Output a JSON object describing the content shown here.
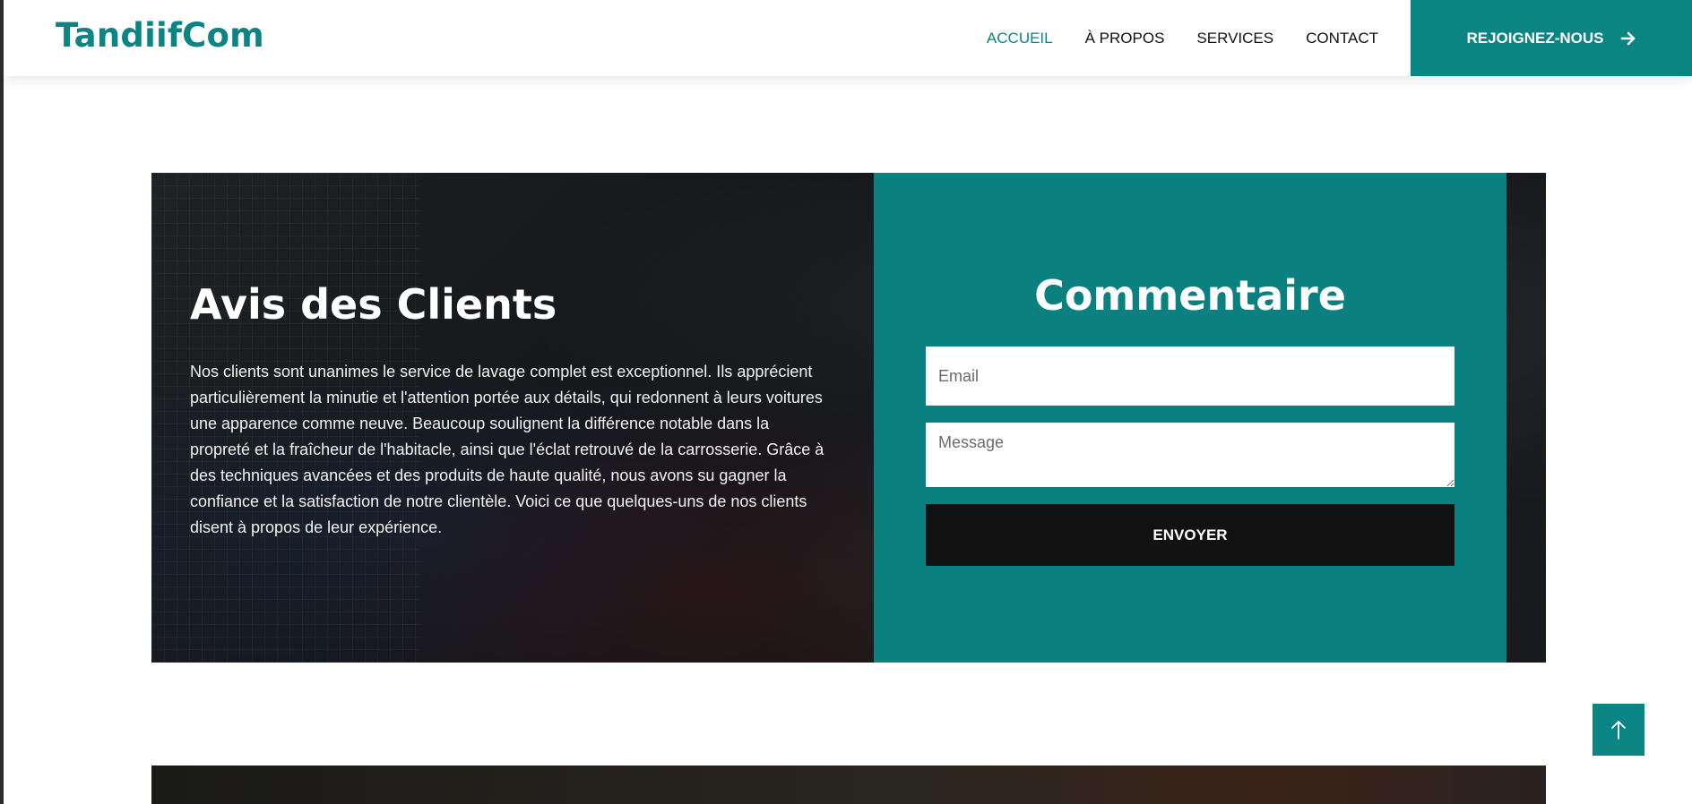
{
  "brand": {
    "name": "TandiifCom"
  },
  "nav": {
    "items": [
      {
        "label": "ACCUEIL",
        "active": true
      },
      {
        "label": "À PROPOS",
        "active": false
      },
      {
        "label": "SERVICES",
        "active": false
      },
      {
        "label": "CONTACT",
        "active": false
      }
    ],
    "cta_label": "REJOIGNEZ-NOUS",
    "cta_icon": "arrow-right-icon"
  },
  "testimonials": {
    "title": "Avis des Clients",
    "text": "Nos clients sont unanimes le service de lavage complet est exceptionnel. Ils apprécient particulièrement la minutie et l'attention portée aux détails, qui redonnent à leurs voitures une apparence comme neuve. Beaucoup soulignent la différence notable dans la propreté et la fraîcheur de l'habitacle, ainsi que l'éclat retrouvé de la carrosserie. Grâce à des techniques avancées et des produits de haute qualité, nous avons su gagner la confiance et la satisfaction de notre clientèle. Voici ce que quelques-uns de nos clients disent à propos de leur expérience."
  },
  "comment_form": {
    "title": "Commentaire",
    "email_placeholder": "Email",
    "message_placeholder": "Message",
    "submit_label": "ENVOYER"
  },
  "back_to_top": {
    "icon": "arrow-up-icon"
  },
  "colors": {
    "accent": "#0b8484",
    "panel": "#0b8080",
    "button_dark": "#111111"
  }
}
